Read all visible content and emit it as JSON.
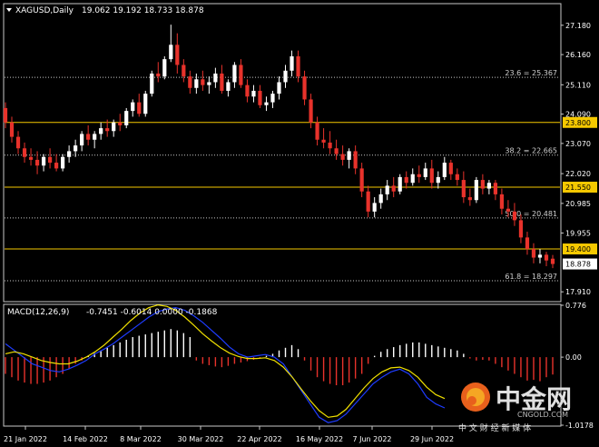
{
  "header": {
    "symbol": "XAGUSD,Daily",
    "ohlc": "19.062 19.192 18.733 18.878"
  },
  "macd": {
    "label": "MACD(12,26,9)",
    "values": "-0.7451 -0.6014 0.0000 -0.1868"
  },
  "colors": {
    "background": "#000000",
    "bull": "#ffffff",
    "bear": "#e8322b",
    "grid": "#c8c8c8",
    "hline": "#f5c800",
    "hline_bg": "#f5c800",
    "hline_text": "#000000",
    "macd_line": "#1e3cff",
    "signal_line": "#f0e000",
    "hist_pos": "#ffffff",
    "hist_neg": "#e8322b"
  },
  "chart_data": [
    {
      "type": "candlestick",
      "title": "XAGUSD,Daily",
      "ylim": [
        17.6,
        27.9
      ],
      "y_ticks": [
        {
          "value": 27.18,
          "label": "27.180"
        },
        {
          "value": 26.16,
          "label": "26.160"
        },
        {
          "value": 25.11,
          "label": "25.110"
        },
        {
          "value": 24.09,
          "label": "24.090"
        },
        {
          "value": 23.07,
          "label": "23.070"
        },
        {
          "value": 22.02,
          "label": "22.020"
        },
        {
          "value": 20.985,
          "label": "20.985"
        },
        {
          "value": 19.955,
          "label": "19.955"
        },
        {
          "value": 17.91,
          "label": "17.910"
        }
      ],
      "x_labels": [
        "21 Jan 2022",
        "14 Feb 2022",
        "8 Mar 2022",
        "30 Mar 2022",
        "22 Apr 2022",
        "16 May 2022",
        "7 Jun 2022",
        "29 Jun 2022"
      ],
      "fib_levels": [
        {
          "value": 25.367,
          "label": "23.6 = 25.367"
        },
        {
          "value": 22.665,
          "label": "38.2 = 22.665"
        },
        {
          "value": 20.481,
          "label": "50.0 = 20.481"
        },
        {
          "value": 18.297,
          "label": "61.8 = 18.297"
        }
      ],
      "horizontal_lines": [
        {
          "value": 23.8,
          "label": "23.800"
        },
        {
          "value": 21.55,
          "label": "21.550"
        },
        {
          "value": 19.4,
          "label": "19.400"
        }
      ],
      "current_price": {
        "value": 18.878,
        "label": "18.878"
      },
      "candles": [
        [
          24.3,
          24.5,
          23.6,
          23.8
        ],
        [
          23.8,
          24.0,
          23.1,
          23.3
        ],
        [
          23.3,
          23.5,
          22.7,
          22.9
        ],
        [
          22.9,
          23.1,
          22.4,
          22.6
        ],
        [
          22.6,
          22.9,
          22.3,
          22.5
        ],
        [
          22.5,
          22.8,
          22.0,
          22.3
        ],
        [
          22.3,
          22.7,
          22.1,
          22.6
        ],
        [
          22.6,
          22.9,
          22.2,
          22.4
        ],
        [
          22.4,
          22.7,
          22.1,
          22.2
        ],
        [
          22.2,
          22.7,
          22.1,
          22.6
        ],
        [
          22.6,
          23.0,
          22.4,
          22.8
        ],
        [
          22.8,
          23.2,
          22.6,
          23.0
        ],
        [
          23.0,
          23.5,
          22.8,
          23.4
        ],
        [
          23.4,
          23.7,
          23.0,
          23.2
        ],
        [
          23.2,
          23.5,
          22.9,
          23.4
        ],
        [
          23.4,
          23.8,
          23.2,
          23.6
        ],
        [
          23.6,
          23.9,
          23.3,
          23.5
        ],
        [
          23.5,
          23.9,
          23.3,
          23.8
        ],
        [
          23.8,
          24.1,
          23.5,
          23.7
        ],
        [
          23.7,
          24.3,
          23.6,
          24.2
        ],
        [
          24.2,
          24.6,
          24.0,
          24.5
        ],
        [
          24.5,
          24.8,
          24.0,
          24.1
        ],
        [
          24.1,
          24.9,
          24.0,
          24.8
        ],
        [
          24.8,
          25.6,
          24.7,
          25.5
        ],
        [
          25.5,
          25.9,
          25.2,
          25.4
        ],
        [
          25.4,
          26.1,
          25.3,
          26.0
        ],
        [
          26.0,
          27.2,
          25.9,
          26.5
        ],
        [
          26.5,
          26.9,
          25.5,
          25.8
        ],
        [
          25.8,
          26.0,
          25.2,
          25.4
        ],
        [
          25.4,
          25.6,
          24.8,
          25.0
        ],
        [
          25.0,
          25.5,
          24.8,
          25.3
        ],
        [
          25.3,
          25.6,
          24.9,
          25.1
        ],
        [
          25.1,
          25.4,
          24.8,
          25.2
        ],
        [
          25.2,
          25.7,
          25.0,
          25.5
        ],
        [
          25.5,
          25.8,
          24.8,
          24.9
        ],
        [
          24.9,
          25.3,
          24.7,
          25.2
        ],
        [
          25.2,
          25.9,
          25.0,
          25.8
        ],
        [
          25.8,
          26.0,
          25.0,
          25.1
        ],
        [
          25.1,
          25.3,
          24.5,
          24.7
        ],
        [
          24.7,
          25.1,
          24.5,
          24.9
        ],
        [
          24.9,
          25.1,
          24.3,
          24.4
        ],
        [
          24.4,
          24.7,
          24.2,
          24.5
        ],
        [
          24.5,
          24.9,
          24.3,
          24.8
        ],
        [
          24.8,
          25.4,
          24.6,
          25.2
        ],
        [
          25.2,
          25.8,
          25.0,
          25.6
        ],
        [
          25.6,
          26.3,
          25.4,
          26.1
        ],
        [
          26.1,
          26.3,
          25.2,
          25.4
        ],
        [
          25.4,
          25.6,
          24.4,
          24.6
        ],
        [
          24.6,
          24.8,
          23.6,
          23.8
        ],
        [
          23.8,
          24.0,
          23.0,
          23.2
        ],
        [
          23.2,
          23.6,
          22.9,
          23.1
        ],
        [
          23.1,
          23.5,
          22.7,
          22.9
        ],
        [
          22.9,
          23.2,
          22.5,
          22.7
        ],
        [
          22.7,
          23.0,
          22.3,
          22.5
        ],
        [
          22.5,
          22.9,
          22.2,
          22.8
        ],
        [
          22.8,
          23.0,
          22.0,
          22.2
        ],
        [
          22.2,
          22.4,
          21.2,
          21.4
        ],
        [
          21.4,
          21.6,
          20.5,
          20.7
        ],
        [
          20.7,
          21.2,
          20.5,
          21.0
        ],
        [
          21.0,
          21.5,
          20.8,
          21.3
        ],
        [
          21.3,
          21.8,
          21.1,
          21.6
        ],
        [
          21.6,
          21.9,
          21.2,
          21.4
        ],
        [
          21.4,
          22.0,
          21.3,
          21.9
        ],
        [
          21.9,
          22.1,
          21.5,
          21.7
        ],
        [
          21.7,
          22.2,
          21.6,
          22.0
        ],
        [
          22.0,
          22.3,
          21.7,
          21.9
        ],
        [
          21.9,
          22.4,
          21.8,
          22.2
        ],
        [
          22.2,
          22.5,
          21.5,
          21.7
        ],
        [
          21.7,
          22.1,
          21.5,
          21.9
        ],
        [
          21.9,
          22.6,
          21.8,
          22.4
        ],
        [
          22.4,
          22.5,
          21.8,
          22.0
        ],
        [
          22.0,
          22.2,
          21.6,
          21.8
        ],
        [
          21.8,
          22.1,
          21.0,
          21.2
        ],
        [
          21.2,
          21.5,
          20.9,
          21.1
        ],
        [
          21.1,
          21.9,
          21.0,
          21.8
        ],
        [
          21.8,
          22.0,
          21.3,
          21.5
        ],
        [
          21.5,
          21.8,
          21.3,
          21.7
        ],
        [
          21.7,
          21.8,
          21.1,
          21.3
        ],
        [
          21.3,
          21.5,
          20.6,
          20.8
        ],
        [
          20.8,
          21.1,
          20.5,
          20.7
        ],
        [
          20.7,
          21.0,
          20.2,
          20.4
        ],
        [
          20.4,
          20.6,
          19.6,
          19.8
        ],
        [
          19.8,
          20.0,
          19.2,
          19.4
        ],
        [
          19.4,
          19.6,
          18.9,
          19.1
        ],
        [
          19.1,
          19.4,
          18.9,
          19.2
        ],
        [
          19.2,
          19.3,
          18.8,
          19.0
        ],
        [
          19.062,
          19.192,
          18.733,
          18.878
        ]
      ]
    },
    {
      "type": "macd",
      "title": "MACD(12,26,9)",
      "ylim": [
        -1.0178,
        0.776
      ],
      "y_ticks": [
        {
          "value": 0.776,
          "label": "0.776"
        },
        {
          "value": 0.0,
          "label": "0.00"
        },
        {
          "value": -1.0178,
          "label": "-1.0178"
        }
      ],
      "histogram": [
        -0.25,
        -0.3,
        -0.35,
        -0.38,
        -0.4,
        -0.4,
        -0.38,
        -0.35,
        -0.3,
        -0.25,
        -0.18,
        -0.1,
        -0.05,
        0.02,
        0.06,
        0.1,
        0.14,
        0.18,
        0.22,
        0.26,
        0.3,
        0.32,
        0.34,
        0.36,
        0.38,
        0.4,
        0.42,
        0.4,
        0.36,
        0.3,
        -0.05,
        -0.1,
        -0.12,
        -0.14,
        -0.15,
        -0.13,
        -0.1,
        -0.08,
        -0.06,
        -0.04,
        -0.02,
        0.02,
        0.05,
        0.1,
        0.14,
        0.18,
        0.12,
        -0.05,
        -0.2,
        -0.3,
        -0.36,
        -0.4,
        -0.42,
        -0.42,
        -0.38,
        -0.32,
        -0.25,
        -0.1,
        0.02,
        0.08,
        0.12,
        0.15,
        0.18,
        0.2,
        0.22,
        0.22,
        0.2,
        0.18,
        0.16,
        0.14,
        0.12,
        0.1,
        0.05,
        -0.02,
        -0.05,
        -0.04,
        -0.05,
        -0.1,
        -0.15,
        -0.2,
        -0.25,
        -0.3,
        -0.35,
        -0.34,
        -0.36,
        -0.3,
        -0.26
      ],
      "macd_line": [
        0.2,
        0.1,
        0.0,
        -0.1,
        -0.15,
        -0.2,
        -0.22,
        -0.18,
        -0.12,
        -0.05,
        0.05,
        0.12,
        0.2,
        0.3,
        0.4,
        0.5,
        0.6,
        0.68,
        0.72,
        0.74,
        0.7,
        0.62,
        0.52,
        0.4,
        0.28,
        0.15,
        0.05,
        0.0,
        0.02,
        0.04,
        0.0,
        -0.1,
        -0.3,
        -0.5,
        -0.7,
        -0.9,
        -0.98,
        -0.95,
        -0.85,
        -0.7,
        -0.55,
        -0.4,
        -0.3,
        -0.22,
        -0.18,
        -0.25,
        -0.4,
        -0.6,
        -0.7,
        -0.76
      ],
      "signal_line": [
        0.05,
        0.08,
        0.05,
        0.0,
        -0.05,
        -0.08,
        -0.1,
        -0.1,
        -0.06,
        0.0,
        0.08,
        0.18,
        0.3,
        0.42,
        0.55,
        0.66,
        0.74,
        0.78,
        0.76,
        0.7,
        0.6,
        0.48,
        0.35,
        0.24,
        0.14,
        0.06,
        0.01,
        -0.02,
        -0.02,
        -0.01,
        -0.05,
        -0.15,
        -0.3,
        -0.48,
        -0.65,
        -0.8,
        -0.9,
        -0.88,
        -0.78,
        -0.62,
        -0.46,
        -0.32,
        -0.22,
        -0.16,
        -0.15,
        -0.2,
        -0.3,
        -0.45,
        -0.56,
        -0.62
      ]
    }
  ],
  "watermark": {
    "text": "中金网",
    "domain": "CNGOLD.COM",
    "tagline": "中 文 财 经 新 媒 体"
  }
}
